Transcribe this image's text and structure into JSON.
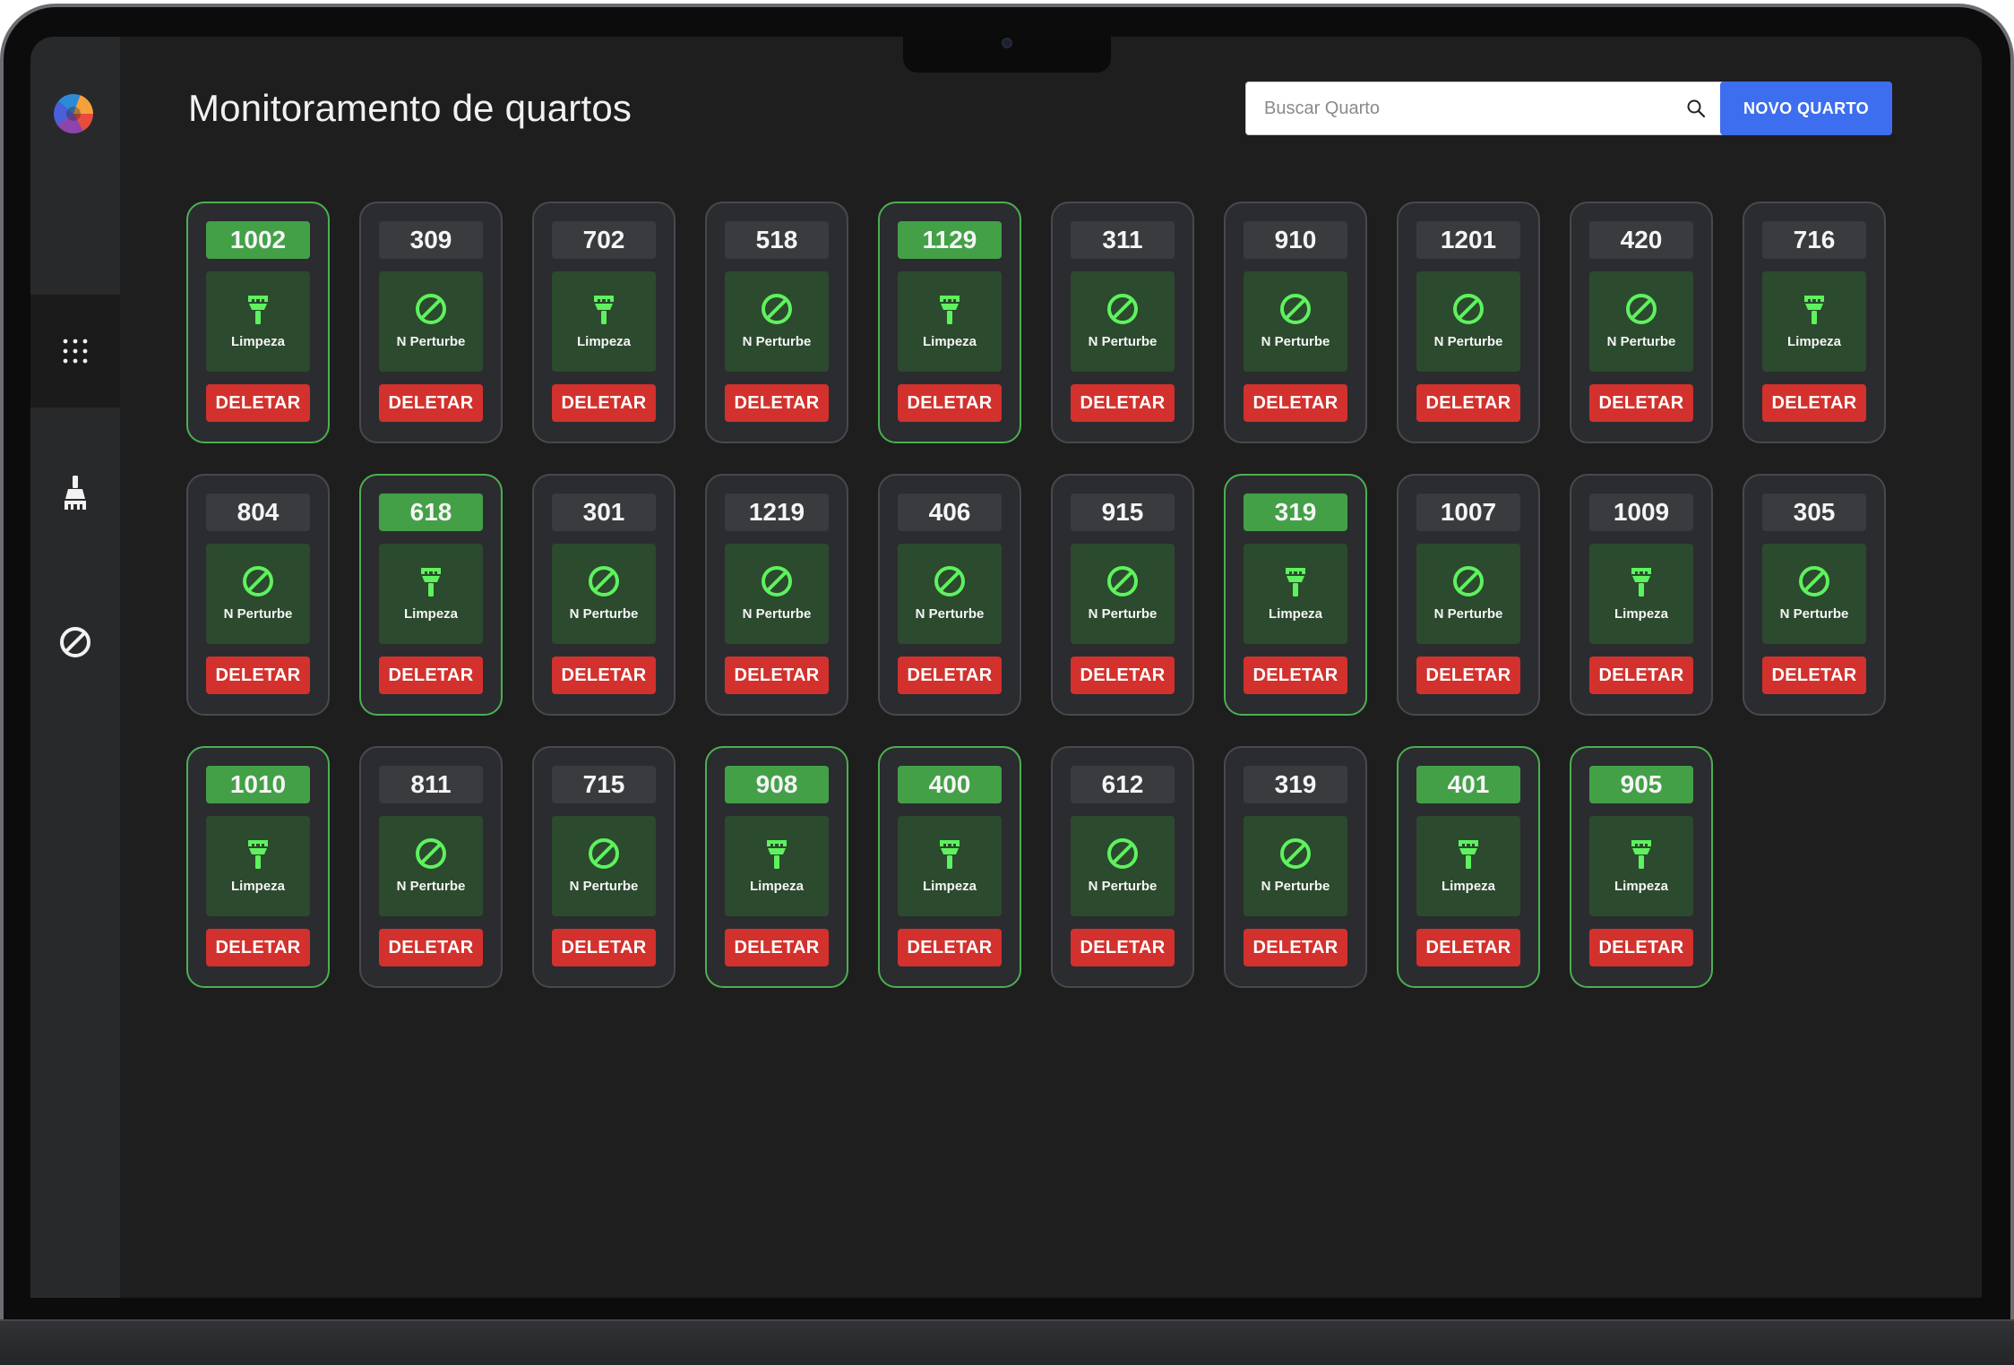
{
  "header": {
    "title": "Monitoramento de quartos",
    "search_placeholder": "Buscar Quarto",
    "new_room_label": "NOVO QUARTO"
  },
  "colors": {
    "accent_blue": "#3d6ef0",
    "cleaning_green": "#43a047",
    "icon_green": "#5ef25e",
    "delete_red": "#d3312d"
  },
  "status_labels": {
    "cleaning": "Limpeza",
    "dnd": "N Perturbe"
  },
  "delete_label": "DELETAR",
  "sidebar": {
    "items": [
      {
        "name": "grid-icon",
        "active": true
      },
      {
        "name": "broom-icon",
        "active": false
      },
      {
        "name": "do-not-disturb-icon",
        "active": false
      }
    ]
  },
  "rooms": [
    {
      "number": "1002",
      "status": "cleaning"
    },
    {
      "number": "309",
      "status": "dnd"
    },
    {
      "number": "702",
      "status": "cleaning_plain"
    },
    {
      "number": "518",
      "status": "dnd"
    },
    {
      "number": "1129",
      "status": "cleaning"
    },
    {
      "number": "311",
      "status": "dnd"
    },
    {
      "number": "910",
      "status": "dnd"
    },
    {
      "number": "1201",
      "status": "dnd"
    },
    {
      "number": "420",
      "status": "dnd"
    },
    {
      "number": "716",
      "status": "cleaning_plain"
    },
    {
      "number": "804",
      "status": "dnd"
    },
    {
      "number": "618",
      "status": "cleaning"
    },
    {
      "number": "301",
      "status": "dnd"
    },
    {
      "number": "1219",
      "status": "dnd"
    },
    {
      "number": "406",
      "status": "dnd"
    },
    {
      "number": "915",
      "status": "dnd"
    },
    {
      "number": "319",
      "status": "cleaning"
    },
    {
      "number": "1007",
      "status": "dnd"
    },
    {
      "number": "1009",
      "status": "cleaning_plain"
    },
    {
      "number": "305",
      "status": "dnd"
    },
    {
      "number": "1010",
      "status": "cleaning"
    },
    {
      "number": "811",
      "status": "dnd"
    },
    {
      "number": "715",
      "status": "dnd"
    },
    {
      "number": "908",
      "status": "cleaning"
    },
    {
      "number": "400",
      "status": "cleaning"
    },
    {
      "number": "612",
      "status": "dnd"
    },
    {
      "number": "319",
      "status": "dnd"
    },
    {
      "number": "401",
      "status": "cleaning"
    },
    {
      "number": "905",
      "status": "cleaning"
    }
  ]
}
